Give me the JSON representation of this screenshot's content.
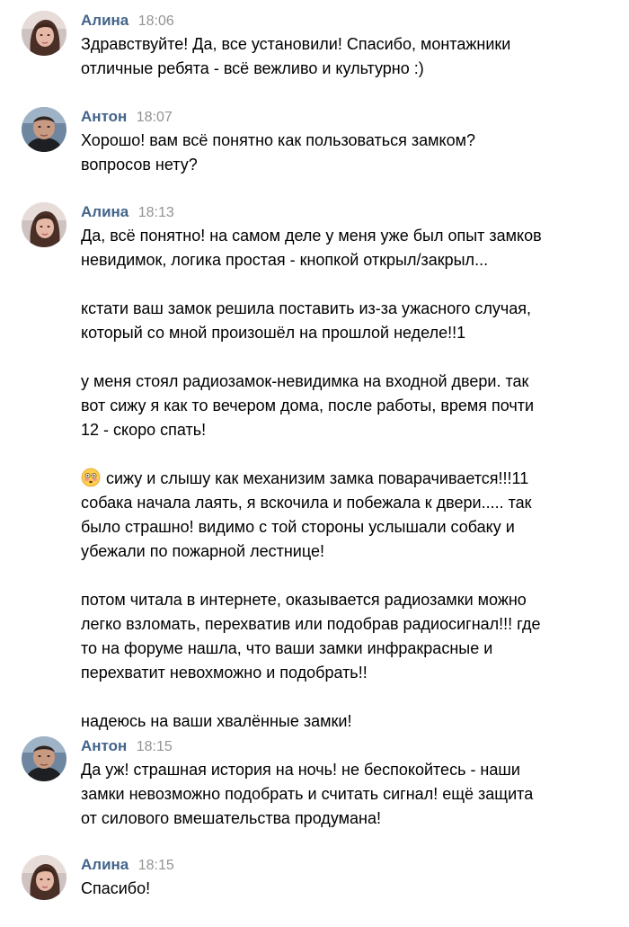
{
  "messages": [
    {
      "author": "Алина",
      "time": "18:06",
      "avatar_icon": "alina-avatar",
      "paragraphs": [
        "Здравствуйте! Да, все установили! Спасибо, монтажники\nотличные ребята - всё вежливо и культурно :)"
      ]
    },
    {
      "author": "Антон",
      "time": "18:07",
      "avatar_icon": "anton-avatar",
      "paragraphs": [
        "Хорошо! вам всё понятно как пользоваться замком?\nвопросов нету?"
      ]
    },
    {
      "author": "Алина",
      "time": "18:13",
      "avatar_icon": "alina-avatar",
      "paragraphs": [
        "Да, всё понятно! на самом деле у меня уже был опыт замков\nневидимок, логика простая - кнопкой открыл/закрыл...",
        "кстати ваш замок решила поставить из-за ужасного случая,\nкоторый со мной произошёл на прошлой неделе!!1",
        "у меня стоял радиозамок-невидимка на входной двери. так\nвот сижу я как то вечером дома, после работы, время почти\n12 - скоро спать!",
        "сижу и слышу как механизим замка поварачивается!!!11\nсобака начала лаять, я вскочила и побежала к двери..... так\nбыло страшно! видимо с той стороны услышали собаку и\nубежали по пожарной лестнице!",
        "потом читала в интернете, оказывается радиозамки можно\nлегко взломать, перехватив или подобрав радиосигнал!!! где\nто на форуме нашла, что ваши замки инфракрасные и\nперехватит невохможно и подобрать!!",
        "надеюсь на ваши хвалённые замки!"
      ],
      "emoji_paragraph_index": 3,
      "emoji_icon": "flushed-face-emoji-icon"
    },
    {
      "author": "Антон",
      "time": "18:15",
      "avatar_icon": "anton-avatar",
      "paragraphs": [
        "Да уж! страшная история на ночь! не беспокойтесь - наши\nзамки невозможно подобрать и считать сигнал! ещё защита\nот силового вмешательства продумана!"
      ]
    },
    {
      "author": "Алина",
      "time": "18:15",
      "avatar_icon": "alina-avatar",
      "paragraphs": [
        "Спасибо!"
      ]
    }
  ],
  "colors": {
    "author_name": "#42648b",
    "timestamp": "#939393",
    "message_text": "#000000",
    "background": "#ffffff"
  }
}
